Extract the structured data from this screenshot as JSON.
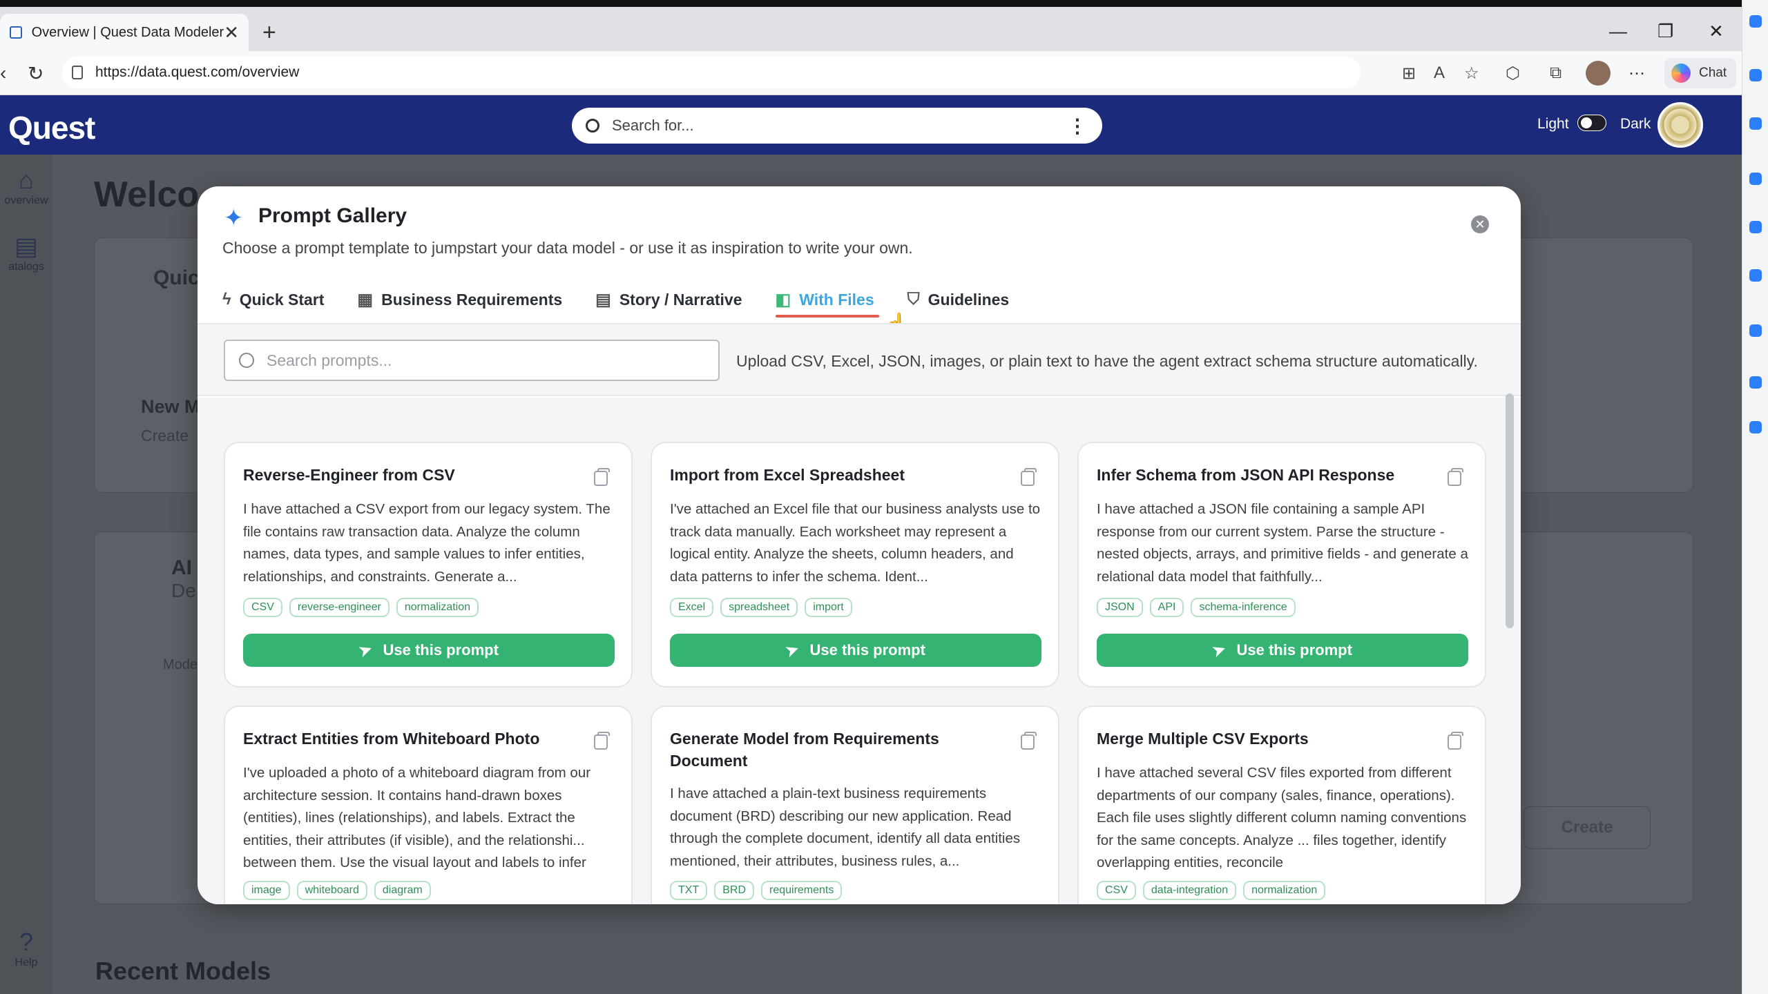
{
  "browser": {
    "tab_title": "Overview | Quest Data Modeler",
    "tab_close": "✕",
    "new_tab": "+",
    "url": "https://data.quest.com/overview",
    "chat_label": "Chat",
    "controls": {
      "minimize": "—",
      "restore": "❐",
      "close": "✕"
    }
  },
  "app": {
    "brand": "Quest",
    "search_placeholder": "Search for...",
    "light_label": "Light",
    "dark_label": "Dark",
    "sidebar": [
      {
        "label": "overview",
        "icon": "home-icon"
      },
      {
        "label": "atalogs",
        "icon": "catalog-icon"
      },
      {
        "label": "Help",
        "icon": "help-icon"
      }
    ],
    "bg": {
      "welcome": "Welco",
      "quick": "Quic",
      "new_m": "New M",
      "create_sub": "Create",
      "ai": "AI",
      "de": "De",
      "mode": "Mode",
      "create_btn": "Create",
      "recent_models": "Recent Models"
    }
  },
  "modal": {
    "title": "Prompt Gallery",
    "subtitle": "Choose a prompt template to jumpstart your data model - or use it as inspiration to write your own.",
    "tabs": [
      {
        "label": "Quick Start",
        "icon": "lightning-icon",
        "active": false
      },
      {
        "label": "Business Requirements",
        "icon": "building-icon",
        "active": false
      },
      {
        "label": "Story / Narrative",
        "icon": "book-icon",
        "active": false
      },
      {
        "label": "With Files",
        "icon": "file-icon",
        "active": true
      },
      {
        "label": "Guidelines",
        "icon": "shield-icon",
        "active": false
      }
    ],
    "search_placeholder": "Search prompts...",
    "hint": "Upload CSV, Excel, JSON, images, or plain text to have the agent extract schema structure automatically.",
    "use_label": "Use this prompt",
    "cards": [
      {
        "title": "Reverse-Engineer from CSV",
        "desc": "I have attached a CSV export from our legacy system. The file contains raw transaction data. Analyze the column names, data types, and sample values to infer entities, relationships, and constraints. Generate a...",
        "tags": [
          "CSV",
          "reverse-engineer",
          "normalization"
        ]
      },
      {
        "title": "Import from Excel Spreadsheet",
        "desc": "I've attached an Excel file that our business analysts use to track data manually. Each worksheet may represent a logical entity. Analyze the sheets, column headers, and data patterns to infer the schema. Ident...",
        "tags": [
          "Excel",
          "spreadsheet",
          "import"
        ]
      },
      {
        "title": "Infer Schema from JSON API Response",
        "desc": "I have attached a JSON file containing a sample API response from our current system. Parse the structure - nested objects, arrays, and primitive fields - and generate a relational data model that faithfully...",
        "tags": [
          "JSON",
          "API",
          "schema-inference"
        ]
      },
      {
        "title": "Extract Entities from Whiteboard Photo",
        "desc": "I've uploaded a photo of a whiteboard diagram from our architecture session. It contains hand-drawn boxes (entities), lines (relationships), and labels. Extract the entities, their attributes (if visible), and the relationshi... between them. Use the visual layout and labels to infer",
        "tags": [
          "image",
          "whiteboard",
          "diagram"
        ]
      },
      {
        "title": "Generate Model from Requirements Document",
        "desc": "I have attached a plain-text business requirements document (BRD) describing our new application. Read through the complete document, identify all data entities mentioned, their attributes, business rules, a...",
        "tags": [
          "TXT",
          "BRD",
          "requirements"
        ]
      },
      {
        "title": "Merge Multiple CSV Exports",
        "desc": "I have attached several CSV files exported from different departments of our company (sales, finance, operations). Each file uses slightly different column naming conventions for the same concepts. Analyze ... files together, identify overlapping entities, reconcile",
        "tags": [
          "CSV",
          "data-integration",
          "normalization"
        ]
      }
    ]
  }
}
